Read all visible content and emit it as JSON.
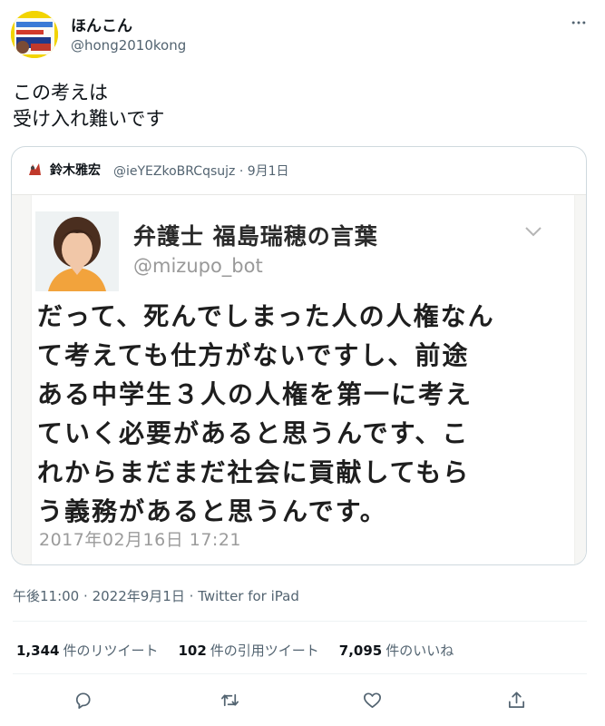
{
  "author": {
    "display_name": "ほんこん",
    "handle": "@hong2010kong",
    "avatar_text": "ウイルスから国民を守る国防や"
  },
  "tweet": {
    "lines": [
      "この考えは",
      "受け入れ難いです"
    ]
  },
  "quoted": {
    "name": "鈴木雅宏",
    "handle": "@ieYEZkoBRCqsujz",
    "separator": "·",
    "date": "9月1日",
    "image": {
      "name": "弁護士 福島瑞穂の言葉",
      "handle": "@mizupo_bot",
      "lines": [
        "だって、死んでしまった人の人権なん",
        "て考えても仕方がないですし、前途",
        "ある中学生３人の人権を第一に考え",
        "ていく必要があると思うんです、こ",
        "れからまだまだ社会に貢献してもら",
        "う義務があると思うんです。"
      ],
      "date": "2017年02月16日 17:21"
    }
  },
  "meta": {
    "time": "午後11:00",
    "date": "2022年9月1日",
    "sep": "·",
    "source": "Twitter for iPad"
  },
  "stats": {
    "retweets_count": "1,344",
    "retweets_label": "件のリツイート",
    "quotes_count": "102",
    "quotes_label": "件の引用ツイート",
    "likes_count": "7,095",
    "likes_label": "件のいいね"
  },
  "icons": {
    "more": "more-dots-icon",
    "reply": "reply-icon",
    "retweet": "retweet-icon",
    "like": "like-icon",
    "share": "share-icon"
  },
  "colors": {
    "text_primary": "#0f1419",
    "text_secondary": "#536471",
    "border": "#cfd9de",
    "divider": "#eff3f4"
  }
}
